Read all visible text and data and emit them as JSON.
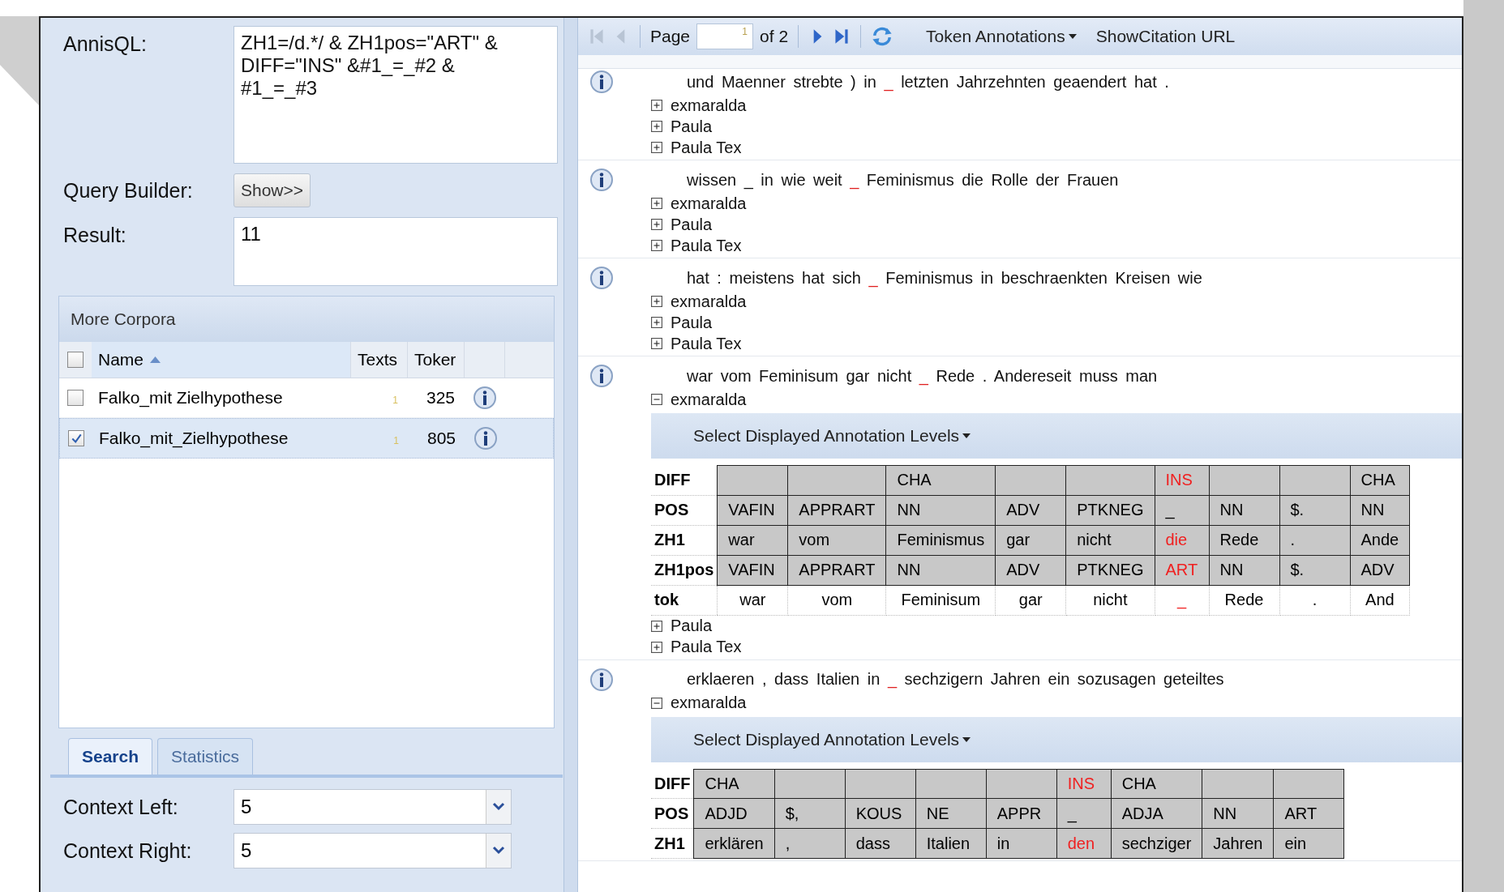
{
  "query": {
    "label": "AnnisQL:",
    "value": "ZH1=/d.*/ & ZH1pos=\"ART\" &\nDIFF=\"INS\" &#1_=_#2 &\n#1_=_#3"
  },
  "query_builder": {
    "label": "Query Builder:",
    "button": "Show>>"
  },
  "result": {
    "label": "Result:",
    "value": "11"
  },
  "corpora": {
    "title": "More Corpora",
    "columns": [
      {
        "label": "Name",
        "sorted": true
      },
      {
        "label": "Texts",
        "sorted": false
      },
      {
        "label": "Toker",
        "sorted": false
      }
    ],
    "all_checked": false,
    "rows": [
      {
        "name": "Falko_mit Zielhypothese",
        "texts": "1",
        "tokens": "325",
        "checked": false,
        "selected": false
      },
      {
        "name": "Falko_mit_Zielhypothese",
        "texts": "1",
        "tokens": "805",
        "checked": true,
        "selected": true
      }
    ]
  },
  "tabs": [
    {
      "label": "Search",
      "selected": true
    },
    {
      "label": "Statistics",
      "selected": false
    }
  ],
  "context": [
    {
      "label": "Context Left:",
      "value": "5"
    },
    {
      "label": "Context Right:",
      "value": "5"
    }
  ],
  "toolbar": {
    "page_label": "Page",
    "page": "1",
    "of": "of 2",
    "token_annotations": "Token Annotations",
    "citation": "ShowCitation URL"
  },
  "hits": [
    {
      "before": "und Maenner strebte ) in",
      "marker": "_",
      "after": "letzten Jahrzehnten geaendert hat .",
      "layers": [
        {
          "label": "exmaralda",
          "expanded": false
        },
        {
          "label": "Paula",
          "expanded": false
        },
        {
          "label": "Paula Tex",
          "expanded": false
        }
      ]
    },
    {
      "before": "wissen _ in wie weit",
      "marker": "_",
      "after": "Feminismus die Rolle der Frauen",
      "layers": [
        {
          "label": "exmaralda",
          "expanded": false
        },
        {
          "label": "Paula",
          "expanded": false
        },
        {
          "label": "Paula Tex",
          "expanded": false
        }
      ]
    },
    {
      "before": "hat : meistens hat sich",
      "marker": "_",
      "after": "Feminismus in beschraenkten Kreisen wie",
      "layers": [
        {
          "label": "exmaralda",
          "expanded": false
        },
        {
          "label": "Paula",
          "expanded": false
        },
        {
          "label": "Paula Tex",
          "expanded": false
        }
      ]
    },
    {
      "before": "war vom Feminisum gar nicht",
      "marker": "_",
      "after": "Rede . Andereseit muss man",
      "layers": [
        {
          "label": "exmaralda",
          "expanded": true,
          "levels_menu": "Select Displayed Annotation Levels",
          "grid": [
            {
              "label": "DIFF",
              "kind": "annotation",
              "cells": [
                {
                  "red": false
                },
                {
                  "red": false
                },
                {
                  "text": "CHA",
                  "red": false
                },
                {
                  "red": false
                },
                {
                  "red": false
                },
                {
                  "text": "INS",
                  "red": true
                },
                {
                  "red": false
                },
                {
                  "red": false
                },
                {
                  "text": "CHA",
                  "red": false
                }
              ]
            },
            {
              "label": "POS",
              "kind": "annotation",
              "cells": [
                {
                  "text": "VAFIN",
                  "red": false
                },
                {
                  "text": "APPRART",
                  "red": false
                },
                {
                  "text": "NN",
                  "red": false
                },
                {
                  "text": "ADV",
                  "red": false
                },
                {
                  "text": "PTKNEG",
                  "red": false
                },
                {
                  "text": "_",
                  "red": false
                },
                {
                  "text": "NN",
                  "red": false
                },
                {
                  "text": "$.",
                  "red": false
                },
                {
                  "text": "NN",
                  "red": false
                }
              ]
            },
            {
              "label": "ZH1",
              "kind": "annotation",
              "cells": [
                {
                  "text": "war",
                  "red": false
                },
                {
                  "text": "vom",
                  "red": false
                },
                {
                  "text": "Feminismus",
                  "red": false
                },
                {
                  "text": "gar",
                  "red": false
                },
                {
                  "text": "nicht",
                  "red": false
                },
                {
                  "text": "die",
                  "red": true
                },
                {
                  "text": "Rede",
                  "red": false
                },
                {
                  "text": ".",
                  "red": false
                },
                {
                  "text": "Ande",
                  "red": false
                }
              ]
            },
            {
              "label": "ZH1pos",
              "kind": "annotation",
              "cells": [
                {
                  "text": "VAFIN",
                  "red": false
                },
                {
                  "text": "APPRART",
                  "red": false
                },
                {
                  "text": "NN",
                  "red": false
                },
                {
                  "text": "ADV",
                  "red": false
                },
                {
                  "text": "PTKNEG",
                  "red": false
                },
                {
                  "text": "ART",
                  "red": true
                },
                {
                  "text": "NN",
                  "red": false
                },
                {
                  "text": "$.",
                  "red": false
                },
                {
                  "text": "ADV",
                  "red": false
                }
              ]
            },
            {
              "label": "tok",
              "kind": "token",
              "cells": [
                {
                  "text": "war",
                  "red": false
                },
                {
                  "text": "vom",
                  "red": false
                },
                {
                  "text": "Feminisum",
                  "red": false
                },
                {
                  "text": "gar",
                  "red": false
                },
                {
                  "text": "nicht",
                  "red": false
                },
                {
                  "text": "_",
                  "red": true
                },
                {
                  "text": "Rede",
                  "red": false
                },
                {
                  "text": ".",
                  "red": false
                },
                {
                  "text": "And",
                  "red": false
                }
              ]
            }
          ]
        },
        {
          "label": "Paula",
          "expanded": false
        },
        {
          "label": "Paula Tex",
          "expanded": false
        }
      ]
    },
    {
      "before": "erklaeren , dass Italien in",
      "marker": "_",
      "after": "sechzigern Jahren ein sozusagen geteiltes",
      "layers": [
        {
          "label": "exmaralda",
          "expanded": true,
          "levels_menu": "Select Displayed Annotation Levels",
          "grid": [
            {
              "label": "DIFF",
              "kind": "annotation",
              "cells": [
                {
                  "text": "CHA",
                  "red": false
                },
                {
                  "red": false
                },
                {
                  "red": false
                },
                {
                  "red": false
                },
                {
                  "red": false
                },
                {
                  "text": "INS",
                  "red": true
                },
                {
                  "text": "CHA",
                  "red": false
                },
                {
                  "red": false
                },
                {
                  "red": false
                }
              ]
            },
            {
              "label": "POS",
              "kind": "annotation",
              "cells": [
                {
                  "text": "ADJD",
                  "red": false
                },
                {
                  "text": "$,",
                  "red": false
                },
                {
                  "text": "KOUS",
                  "red": false
                },
                {
                  "text": "NE",
                  "red": false
                },
                {
                  "text": "APPR",
                  "red": false
                },
                {
                  "text": "_",
                  "red": false
                },
                {
                  "text": "ADJA",
                  "red": false
                },
                {
                  "text": "NN",
                  "red": false
                },
                {
                  "text": "ART",
                  "red": false
                }
              ]
            },
            {
              "label": "ZH1",
              "kind": "annotation",
              "cells": [
                {
                  "text": "erklären",
                  "red": false
                },
                {
                  "text": ",",
                  "red": false
                },
                {
                  "text": "dass",
                  "red": false
                },
                {
                  "text": "Italien",
                  "red": false
                },
                {
                  "text": "in",
                  "red": false
                },
                {
                  "text": "den",
                  "red": true
                },
                {
                  "text": "sechziger",
                  "red": false
                },
                {
                  "text": "Jahren",
                  "red": false
                },
                {
                  "text": "ein",
                  "red": false
                }
              ]
            }
          ]
        }
      ]
    }
  ]
}
